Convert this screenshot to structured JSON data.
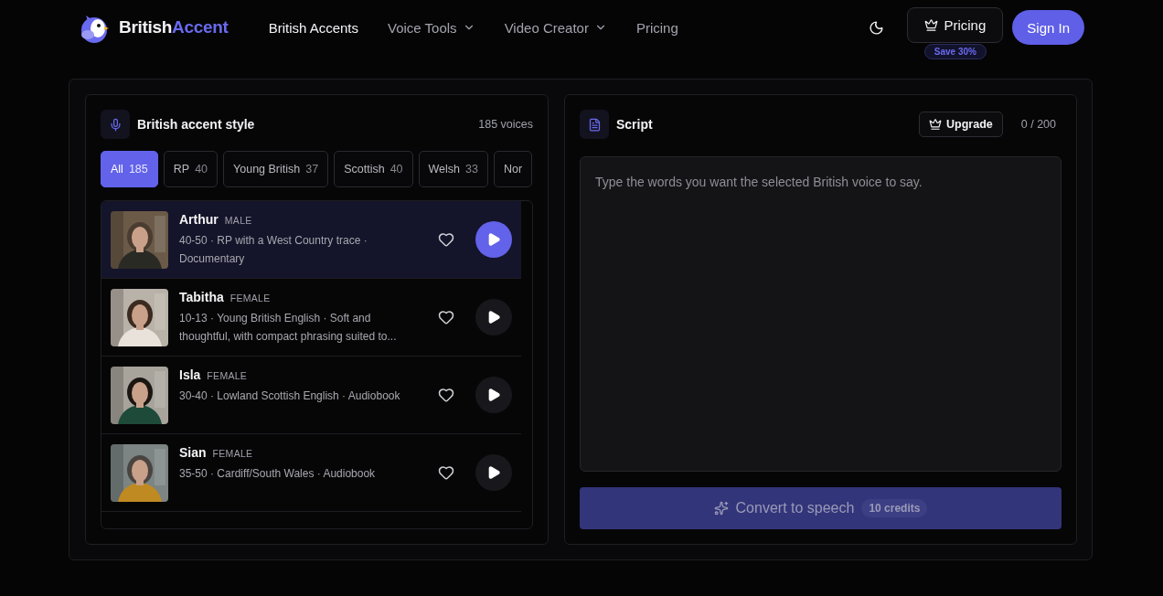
{
  "brand": {
    "name_part_1": "British",
    "name_part_2": "Accent"
  },
  "nav": [
    {
      "label": "British Accents",
      "selected": true,
      "dropdown": false
    },
    {
      "label": "Voice Tools",
      "selected": false,
      "dropdown": true
    },
    {
      "label": "Video Creator",
      "selected": false,
      "dropdown": true
    },
    {
      "label": "Pricing",
      "selected": false,
      "dropdown": false
    }
  ],
  "header_actions": {
    "pricing_button": "Pricing",
    "pricing_badge": "Save 30%",
    "sign_in": "Sign In"
  },
  "voices_panel": {
    "title": "British accent style",
    "count": "185 voices",
    "filters": [
      {
        "label": "All",
        "count": "185",
        "selected": true
      },
      {
        "label": "RP",
        "count": "40",
        "selected": false
      },
      {
        "label": "Young British",
        "count": "37",
        "selected": false
      },
      {
        "label": "Scottish",
        "count": "40",
        "selected": false
      },
      {
        "label": "Welsh",
        "count": "33",
        "selected": false
      },
      {
        "label": "Nor",
        "selected": false
      }
    ],
    "voices": [
      {
        "name": "Arthur",
        "gender": "MALE",
        "description": "40-50 · RP with a West Country trace · Documentary",
        "selected": true
      },
      {
        "name": "Tabitha",
        "gender": "FEMALE",
        "description": "10-13 · Young British English · Soft and thoughtful, with compact phrasing suited to...",
        "selected": false
      },
      {
        "name": "Isla",
        "gender": "FEMALE",
        "description": "30-40 · Lowland Scottish English · Audiobook",
        "selected": false
      },
      {
        "name": "Sian",
        "gender": "FEMALE",
        "description": "35-50 · Cardiff/South Wales · Audiobook",
        "selected": false
      }
    ]
  },
  "script_panel": {
    "title": "Script",
    "upgrade": "Upgrade",
    "char_count": "0 / 200",
    "placeholder": "Type the words you want the selected British voice to say.",
    "convert_button": {
      "label": "Convert to speech",
      "credits": "10 credits",
      "disabled": true
    }
  }
}
